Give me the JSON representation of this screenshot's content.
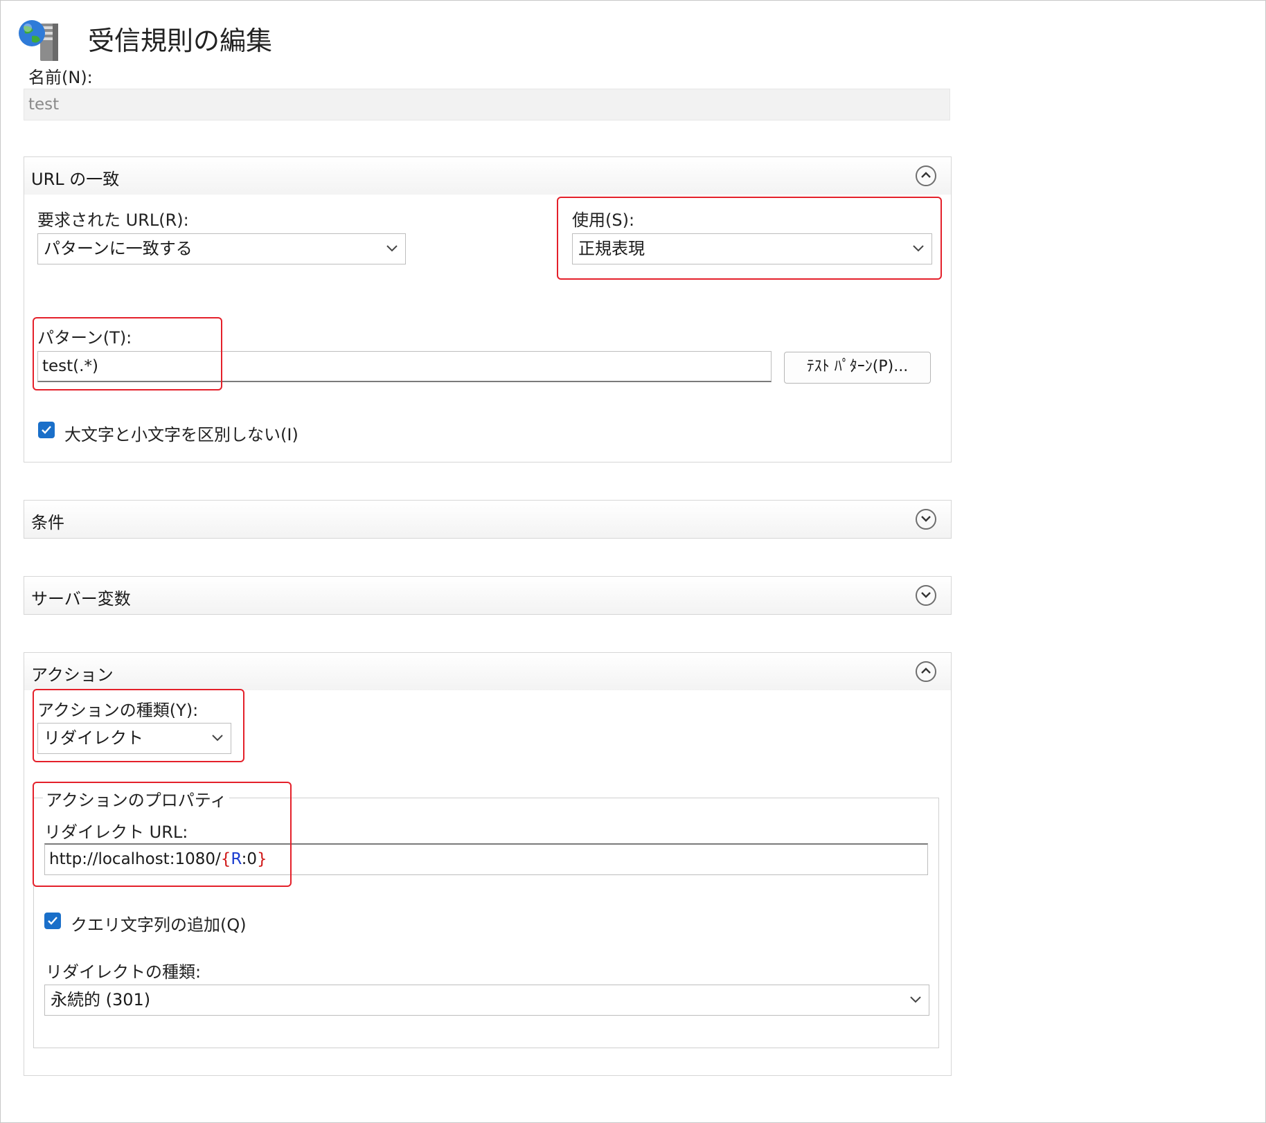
{
  "title": "受信規則の編集",
  "icon": "globe-server-icon",
  "name_label": "名前(N):",
  "name_value": "test",
  "url_match": {
    "header": "URL の一致",
    "requested_url_label": "要求された URL(R):",
    "requested_url_value": "パターンに一致する",
    "using_label": "使用(S):",
    "using_value": "正規表現",
    "pattern_label": "パターン(T):",
    "pattern_value": "test(.*)",
    "test_button": "ﾃｽﾄ ﾊﾟﾀｰﾝ(P)...",
    "ignore_case_label": "大文字と小文字を区別しない(I)",
    "ignore_case_checked": true
  },
  "conditions": {
    "header": "条件"
  },
  "server_variables": {
    "header": "サーバー変数"
  },
  "action": {
    "header": "アクション",
    "type_label": "アクションの種類(Y):",
    "type_value": "リダイレクト",
    "properties_legend": "アクションのプロパティ",
    "redirect_url_label": "リダイレクト URL:",
    "redirect_url_prefix": "http://localhost:1080/",
    "redirect_url_brace_open": "{",
    "redirect_url_var": "R",
    "redirect_url_suffix": ":0",
    "redirect_url_brace_close": "}",
    "append_query_label": "クエリ文字列の追加(Q)",
    "append_query_checked": true,
    "redirect_type_label": "リダイレクトの種類:",
    "redirect_type_value": "永続的 (301)"
  },
  "colors": {
    "highlight": "#e4202a",
    "checkbox": "#1a6fc9",
    "brace": "#d01818",
    "var": "#1a3cd0"
  }
}
